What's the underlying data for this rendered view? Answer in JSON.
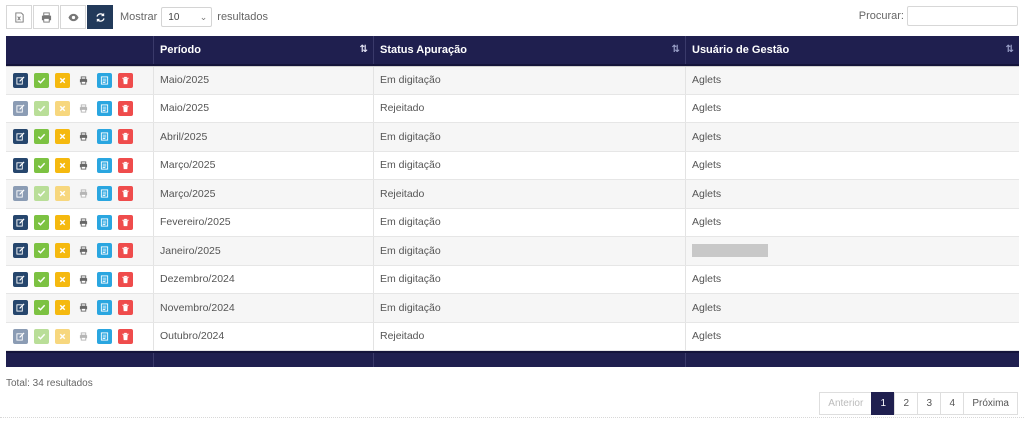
{
  "toolbar": {
    "buttons": [
      {
        "icon": "excel-export-icon",
        "active": false
      },
      {
        "icon": "print-icon",
        "active": false
      },
      {
        "icon": "eye-icon",
        "active": false
      },
      {
        "icon": "refresh-icon",
        "active": true
      }
    ],
    "show_label": "Mostrar",
    "page_size": "10",
    "results_label": "resultados"
  },
  "search": {
    "label": "Procurar:",
    "value": ""
  },
  "table": {
    "columns": [
      {
        "label": "",
        "sort": "none"
      },
      {
        "label": "Período",
        "sort": "active"
      },
      {
        "label": "Status Apuração",
        "sort": "both"
      },
      {
        "label": "Usuário de Gestão",
        "sort": "both"
      }
    ],
    "rows": [
      {
        "periodo": "Maio/2025",
        "status": "Em digitação",
        "usuario": "Aglets",
        "dim": false
      },
      {
        "periodo": "Maio/2025",
        "status": "Rejeitado",
        "usuario": "Aglets",
        "dim": true
      },
      {
        "periodo": "Abril/2025",
        "status": "Em digitação",
        "usuario": "Aglets",
        "dim": false
      },
      {
        "periodo": "Março/2025",
        "status": "Em digitação",
        "usuario": "Aglets",
        "dim": false
      },
      {
        "periodo": "Março/2025",
        "status": "Rejeitado",
        "usuario": "Aglets",
        "dim": true
      },
      {
        "periodo": "Fevereiro/2025",
        "status": "Em digitação",
        "usuario": "Aglets",
        "dim": false
      },
      {
        "periodo": "Janeiro/2025",
        "status": "Em digitação",
        "usuario": "",
        "dim": false
      },
      {
        "periodo": "Dezembro/2024",
        "status": "Em digitação",
        "usuario": "Aglets",
        "dim": false
      },
      {
        "periodo": "Novembro/2024",
        "status": "Em digitação",
        "usuario": "Aglets",
        "dim": false
      },
      {
        "periodo": "Outubro/2024",
        "status": "Rejeitado",
        "usuario": "Aglets",
        "dim": true
      }
    ],
    "row_actions": [
      "edit-icon",
      "check-icon",
      "close-icon",
      "print-icon",
      "document-icon",
      "trash-icon"
    ]
  },
  "footer": {
    "total": "Total: 34 resultados",
    "pagination": {
      "prev": "Anterior",
      "pages": [
        "1",
        "2",
        "3",
        "4"
      ],
      "active_page": "1",
      "next": "Próxima"
    }
  },
  "colors": {
    "header_bg": "#1f1f4f",
    "edit": "#26466d",
    "approve": "#7cc242",
    "reject": "#f5b90f",
    "document": "#2aa6e0",
    "delete": "#ef4c4c"
  }
}
